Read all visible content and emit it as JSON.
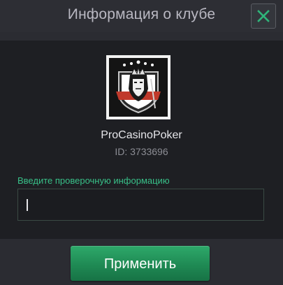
{
  "dialog": {
    "title": "Информация о клубе",
    "close_icon": "close-icon",
    "accent_color": "#2fb57a"
  },
  "club": {
    "avatar_icon": "jack-playing-card-logo",
    "name": "ProCasinoPoker",
    "id_text": "ID: 3733696"
  },
  "verification": {
    "label": "Введите проверочную информацию",
    "value": "",
    "placeholder": ""
  },
  "actions": {
    "apply_label": "Применить"
  }
}
